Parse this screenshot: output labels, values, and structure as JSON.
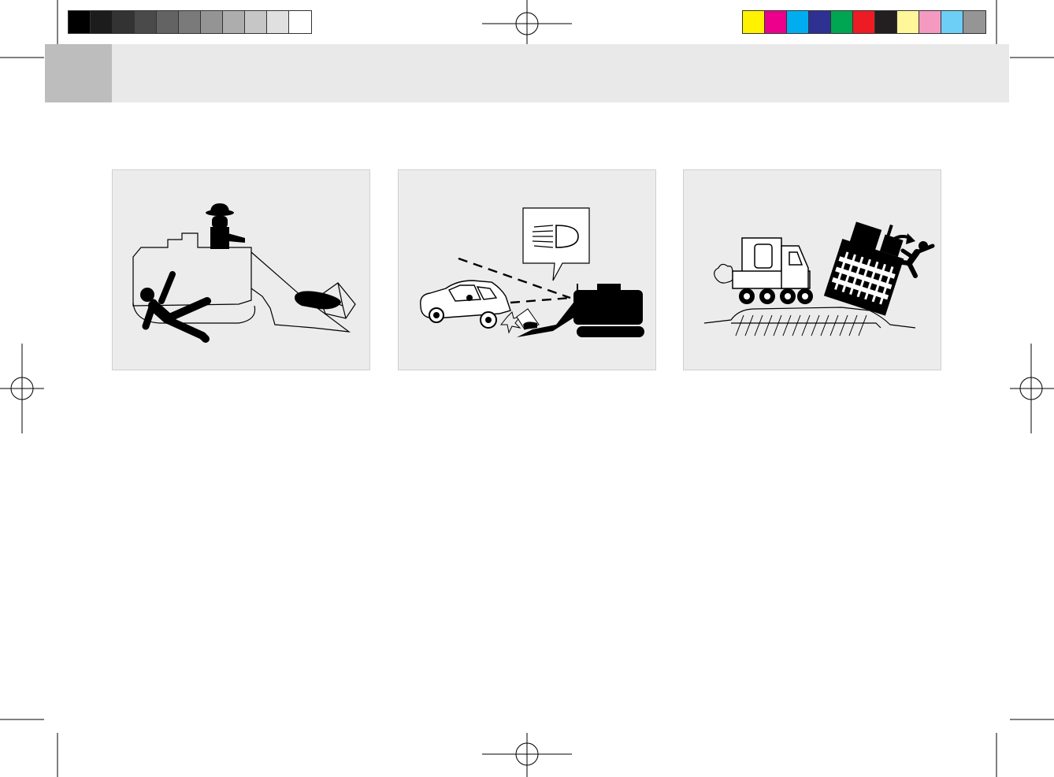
{
  "colors": {
    "gray_bar": [
      "#000000",
      "#1c1c1c",
      "#333333",
      "#4a4a4a",
      "#636363",
      "#7a7a7a",
      "#949494",
      "#adadad",
      "#c6c6c6",
      "#e0e0e0",
      "#ffffff"
    ],
    "color_bar": [
      "#fff200",
      "#ec008c",
      "#00aeef",
      "#2e3192",
      "#00a651",
      "#ed1c24",
      "#231f20",
      "#fff799",
      "#f49ac1",
      "#6dcff6",
      "#959595"
    ],
    "header_band": "#e9e9e9",
    "header_tab": "#bdbdbd",
    "panel_bg": "#ececec"
  },
  "illustrations": [
    {
      "icon": "person-falling-from-bulldozer-icon"
    },
    {
      "icon": "car-collision-headlight-icon"
    },
    {
      "icon": "machine-tipping-over-slope-icon"
    }
  ]
}
